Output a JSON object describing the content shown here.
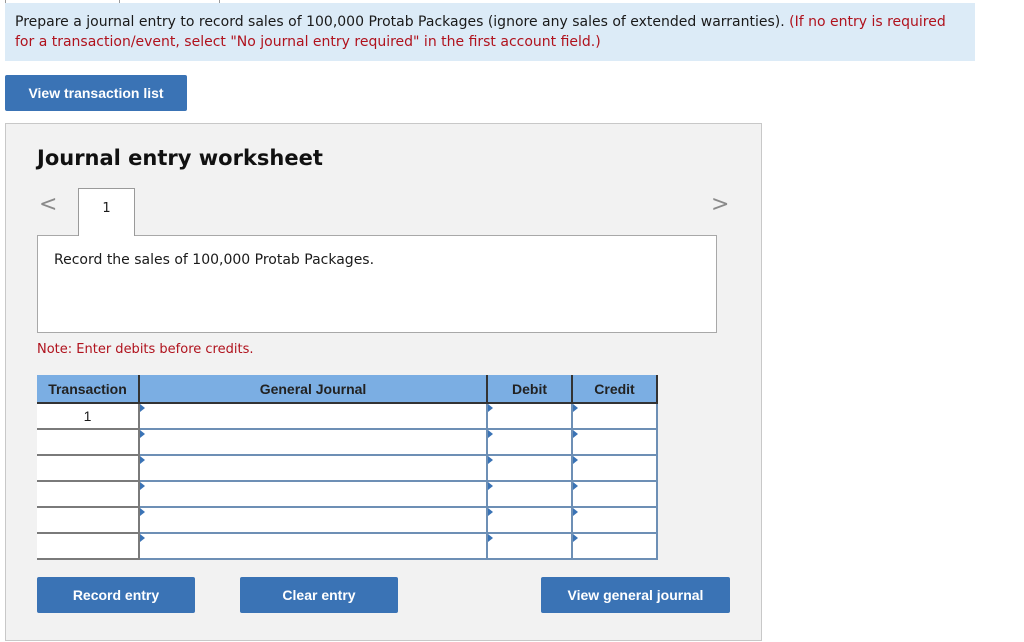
{
  "instruction": {
    "text": "Prepare a journal entry to record sales of 100,000 Protab Packages (ignore any sales of extended warranties). ",
    "note_red": "(If no entry is required for a transaction/event, select \"No journal entry required\" in the first account field.)"
  },
  "buttons": {
    "view_transaction_list": "View transaction list",
    "record_entry": "Record entry",
    "clear_entry": "Clear entry",
    "view_general_journal": "View general journal"
  },
  "worksheet": {
    "title": "Journal entry worksheet",
    "prev_icon": "chevron-left-icon",
    "next_icon": "chevron-right-icon",
    "prev_glyph": "<",
    "next_glyph": ">",
    "active_tab": "1",
    "description": "Record the sales of 100,000 Protab Packages.",
    "note": "Note: Enter debits before credits."
  },
  "table": {
    "headers": [
      "Transaction",
      "General Journal",
      "Debit",
      "Credit"
    ],
    "rows": [
      {
        "transaction": "1",
        "account": "",
        "debit": "",
        "credit": ""
      },
      {
        "transaction": "",
        "account": "",
        "debit": "",
        "credit": ""
      },
      {
        "transaction": "",
        "account": "",
        "debit": "",
        "credit": ""
      },
      {
        "transaction": "",
        "account": "",
        "debit": "",
        "credit": ""
      },
      {
        "transaction": "",
        "account": "",
        "debit": "",
        "credit": ""
      },
      {
        "transaction": "",
        "account": "",
        "debit": "",
        "credit": ""
      }
    ]
  }
}
